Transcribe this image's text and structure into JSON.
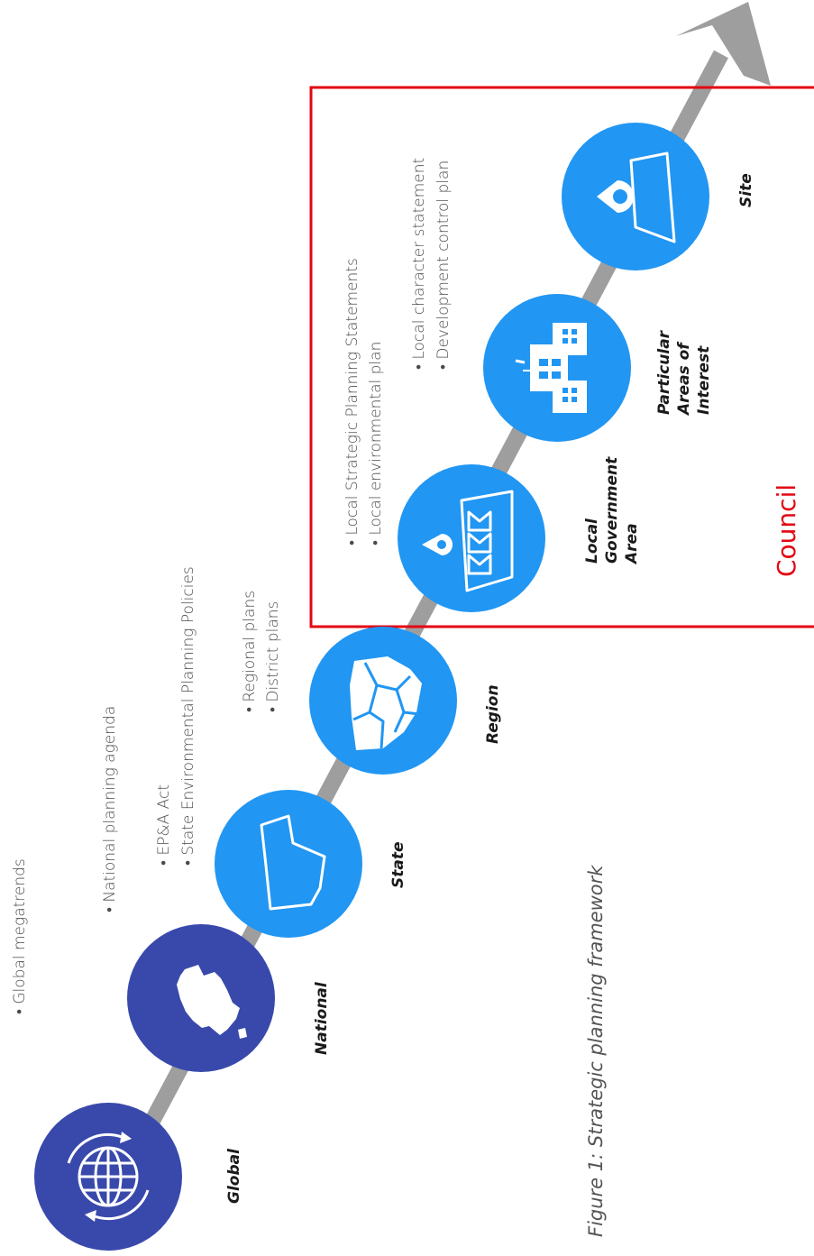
{
  "colors": {
    "dark_circle": "#3949ab",
    "light_circle": "#2196f3",
    "arrow": "#9e9e9e",
    "council_box": "#e30613",
    "icon": "#ffffff"
  },
  "stages": [
    {
      "key": "global",
      "label_lines": [
        "Global"
      ],
      "bullets": [
        "Global megatrends"
      ],
      "icon": "globe-icon",
      "tone": "dark"
    },
    {
      "key": "national",
      "label_lines": [
        "National"
      ],
      "bullets": [
        "National planning agenda"
      ],
      "icon": "australia-map-icon",
      "tone": "dark"
    },
    {
      "key": "state",
      "label_lines": [
        "State"
      ],
      "bullets": [
        "EP&A Act",
        "State Environmental Planning Policies"
      ],
      "icon": "state-map-icon",
      "tone": "light"
    },
    {
      "key": "region",
      "label_lines": [
        "Region"
      ],
      "bullets": [
        "Regional plans",
        "District plans"
      ],
      "icon": "region-map-icon",
      "tone": "light"
    },
    {
      "key": "lga",
      "label_lines": [
        "Local",
        "Government",
        "Area"
      ],
      "bullets": [
        "Local Strategic Planning Statements",
        "Local environmental plan"
      ],
      "icon": "houses-pin-icon",
      "tone": "light"
    },
    {
      "key": "pai",
      "label_lines": [
        "Particular",
        "Areas of",
        "Interest"
      ],
      "bullets": [
        "Local character statement",
        "Development control plan"
      ],
      "icon": "buildings-icon",
      "tone": "light"
    },
    {
      "key": "site",
      "label_lines": [
        "Site"
      ],
      "bullets": [],
      "icon": "site-pin-icon",
      "tone": "light"
    }
  ],
  "council_label": "Council",
  "caption": "Figure 1: Strategic planning framework"
}
